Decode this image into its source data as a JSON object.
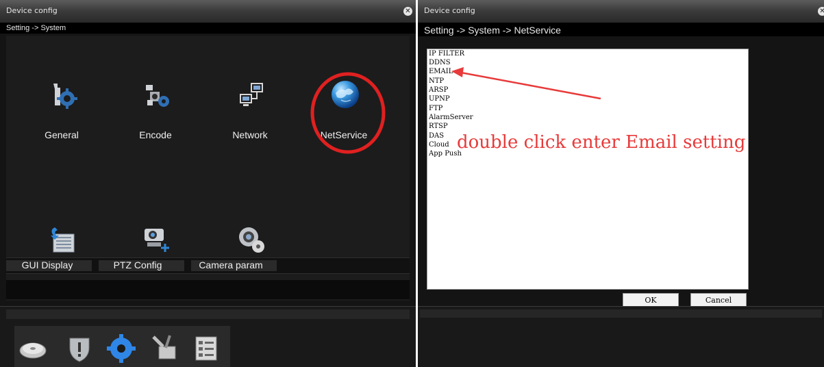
{
  "left_window": {
    "title": "Device config",
    "close_icon": "close-icon",
    "breadcrumb": "Setting -> System",
    "tiles": [
      {
        "label": "General",
        "icon": "general-wrench-gear-icon"
      },
      {
        "label": "Encode",
        "icon": "encode-gears-icon"
      },
      {
        "label": "Network",
        "icon": "network-computers-icon"
      },
      {
        "label": "NetService",
        "icon": "netservice-globe-icon"
      },
      {
        "label": "GUI Display",
        "icon": "gui-display-icon"
      },
      {
        "label": "PTZ Config",
        "icon": "ptz-camera-icon"
      },
      {
        "label": "Camera param",
        "icon": "camera-param-icon"
      }
    ],
    "dock_icons": [
      "disk-icon",
      "shield-icon",
      "system-gear-icon",
      "tools-icon",
      "info-list-icon"
    ]
  },
  "right_window": {
    "title": "Device config",
    "close_icon": "close-icon",
    "breadcrumb": "Setting -> System -> NetService",
    "list": [
      "IP FILTER",
      "DDNS",
      "EMAIL",
      "NTP",
      "ARSP",
      "UPNP",
      "FTP",
      "AlarmServer",
      "RTSP",
      "DAS",
      "Cloud",
      "App Push"
    ],
    "ok_label": "OK",
    "cancel_label": "Cancel"
  },
  "annotation": {
    "text": "double click enter Email setting",
    "color": "#e83a3a"
  },
  "colors": {
    "window_bg": "#141414",
    "highlight_circle": "#e02020"
  }
}
